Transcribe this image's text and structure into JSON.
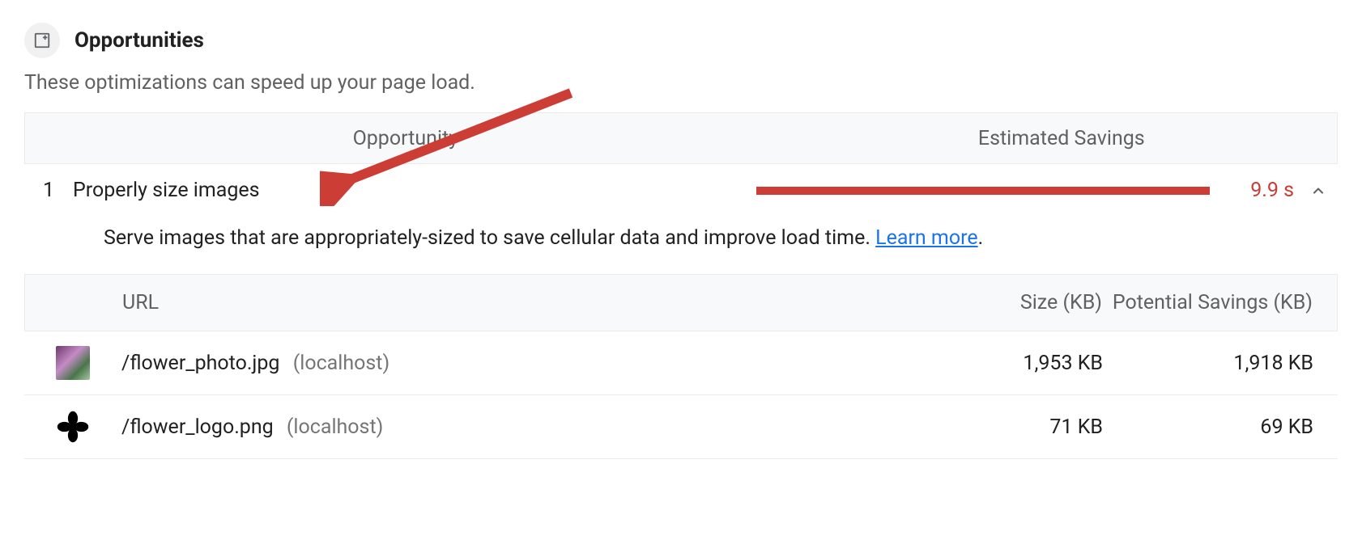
{
  "section": {
    "title": "Opportunities",
    "subtitle": "These optimizations can speed up your page load."
  },
  "columns": {
    "opportunity": "Opportunity",
    "savings": "Estimated Savings"
  },
  "audit": {
    "index": "1",
    "title": "Properly size images",
    "savings_label": "9.9 s",
    "description_prefix": "Serve images that are appropriately-sized to save cellular data and improve load time. ",
    "learn_more": "Learn more",
    "description_suffix": "."
  },
  "detail_columns": {
    "url": "URL",
    "size": "Size (KB)",
    "savings": "Potential Savings (KB)"
  },
  "detail_rows": [
    {
      "path": "/flower_photo.jpg",
      "host": "(localhost)",
      "size": "1,953 KB",
      "savings": "1,918 KB"
    },
    {
      "path": "/flower_logo.png",
      "host": "(localhost)",
      "size": "71 KB",
      "savings": "69 KB"
    }
  ],
  "colors": {
    "fail": "#cc3d35",
    "link": "#1a73e8"
  }
}
